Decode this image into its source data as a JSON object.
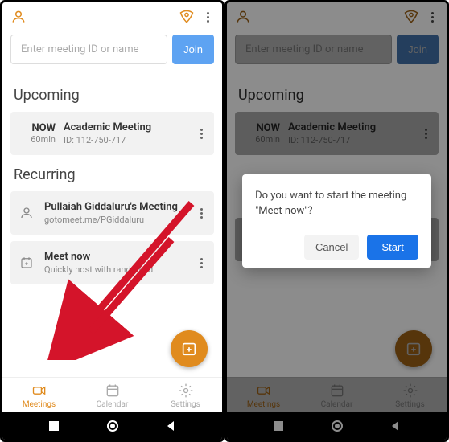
{
  "colors": {
    "accent": "#e08b1e",
    "primary_blue": "#1a73e8",
    "join_blue": "#5ea3f2"
  },
  "search": {
    "placeholder": "Enter meeting ID or name",
    "join_label": "Join"
  },
  "sections": {
    "upcoming": "Upcoming",
    "recurring": "Recurring"
  },
  "upcoming_meeting": {
    "now_label": "NOW",
    "duration": "60min",
    "title": "Academic Meeting",
    "id_label": "ID: 112-750-717"
  },
  "recurring_items": [
    {
      "title": "Pullaiah Giddaluru's Meeting",
      "sub": "gotomeet.me/PGiddaluru"
    },
    {
      "title": "Meet now",
      "sub": "Quickly host with random id"
    }
  ],
  "nav": {
    "meetings": "Meetings",
    "calendar": "Calendar",
    "settings": "Settings"
  },
  "dialog": {
    "text": "Do you want to start the meeting \"Meet now\"?",
    "cancel": "Cancel",
    "start": "Start"
  }
}
